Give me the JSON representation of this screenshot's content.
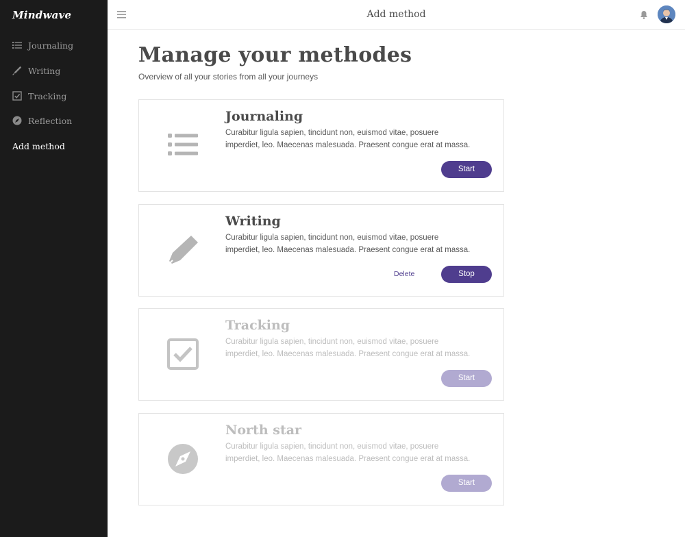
{
  "app": {
    "brand": "Mindwave"
  },
  "sidebar": {
    "items": [
      {
        "label": "Journaling",
        "icon": "list-icon"
      },
      {
        "label": "Writing",
        "icon": "pen-icon"
      },
      {
        "label": "Tracking",
        "icon": "checkbox-icon"
      },
      {
        "label": "Reflection",
        "icon": "compass-icon"
      },
      {
        "label": "Add method",
        "active": true
      }
    ]
  },
  "header": {
    "title": "Add method",
    "icons": [
      "menu-icon",
      "bell-icon",
      "avatar"
    ]
  },
  "main": {
    "title": "Manage your methodes",
    "subtitle": "Overview of all your stories from all your journeys"
  },
  "methods": [
    {
      "title": "Journaling",
      "description": "Curabitur ligula sapien, tincidunt non, euismod vitae, posuere imperdiet, leo. Maecenas malesuada. Praesent congue erat at massa.",
      "icon": "list-icon",
      "primary_label": "Start",
      "enabled": true
    },
    {
      "title": "Writing",
      "description": "Curabitur ligula sapien, tincidunt non, euismod vitae, posuere imperdiet, leo. Maecenas malesuada. Praesent congue erat at massa.",
      "icon": "pen-icon",
      "secondary_label": "Delete",
      "primary_label": "Stop",
      "enabled": true
    },
    {
      "title": "Tracking",
      "description": "Curabitur ligula sapien, tincidunt non, euismod vitae, posuere imperdiet, leo. Maecenas malesuada. Praesent congue erat at massa.",
      "icon": "checkbox-icon",
      "primary_label": "Start",
      "enabled": false
    },
    {
      "title": "North star",
      "description": "Curabitur ligula sapien, tincidunt non, euismod vitae, posuere imperdiet, leo. Maecenas malesuada. Praesent congue erat at massa.",
      "icon": "compass-icon",
      "primary_label": "Start",
      "enabled": false
    }
  ],
  "colors": {
    "sidebar_bg": "#1b1b1b",
    "accent": "#4f3d8e",
    "accent_faded": "#b1aad1",
    "icon_gray": "#b5b5b5"
  }
}
